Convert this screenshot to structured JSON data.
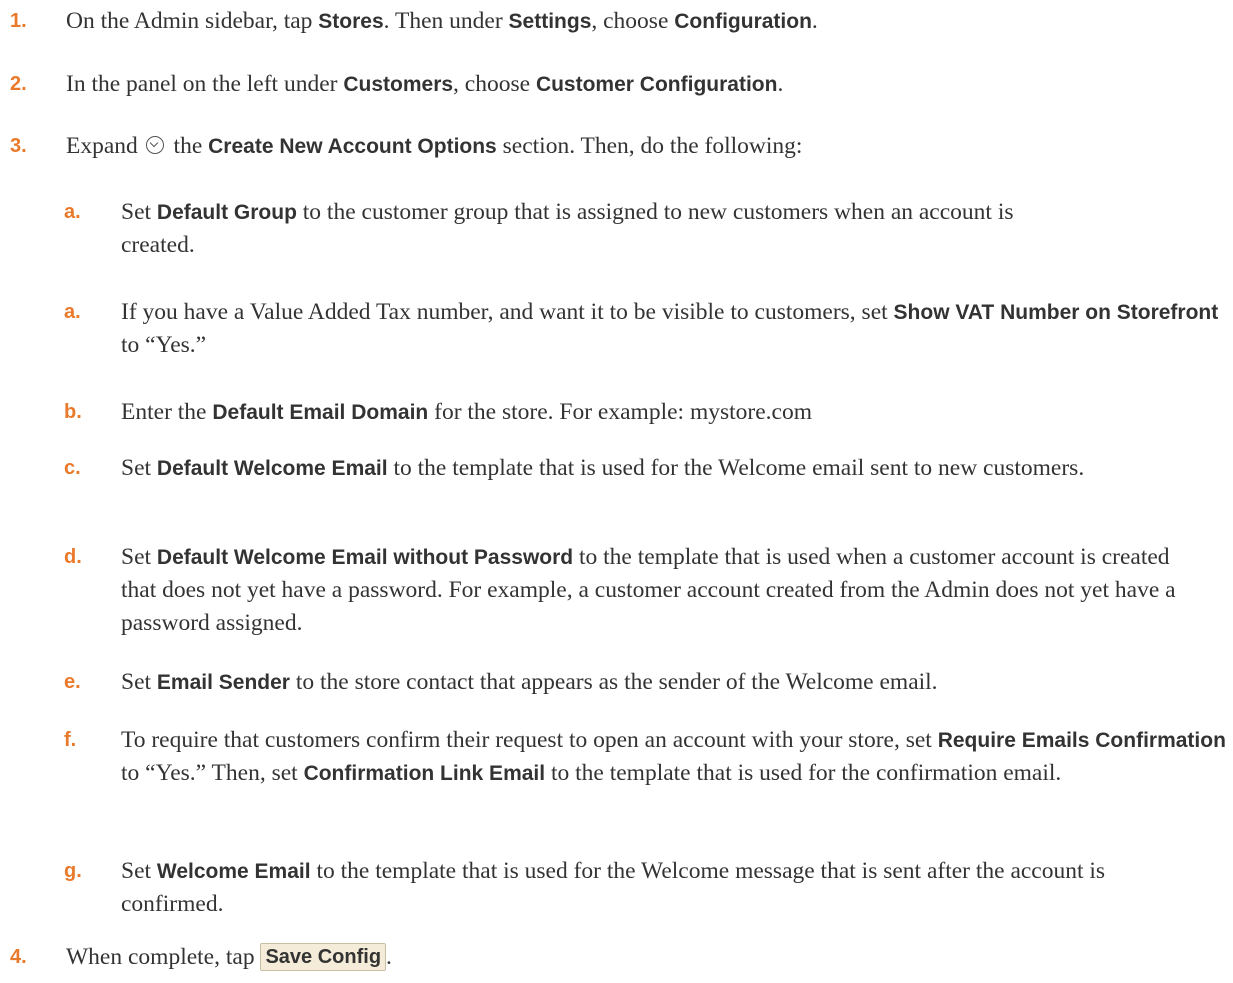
{
  "steps": {
    "s1": {
      "num": "1.",
      "t1": "On the Admin sidebar, tap ",
      "b1": "Stores",
      "t2": ". Then under ",
      "b2": "Settings",
      "t3": ", choose ",
      "b3": "Configuration",
      "t4": "."
    },
    "s2": {
      "num": "2.",
      "t1": "In the panel on the left under ",
      "b1": "Customers",
      "t2": ", choose ",
      "b2": "Customer Configuration",
      "t3": "."
    },
    "s3": {
      "num": "3.",
      "t1": "Expand ",
      "t2": " the ",
      "b1": "Create New Account Options",
      "t3": " section. Then, do the following:",
      "icon": "chevron-circle-down-icon"
    },
    "s4": {
      "num": "4.",
      "t1": "When complete, tap ",
      "button": "Save Config",
      "t2": "."
    }
  },
  "substeps": {
    "a1": {
      "num": "a.",
      "t1": "Set ",
      "b1": "Default Group",
      "t2": " to the customer group that is assigned to new customers when an account is created."
    },
    "a2": {
      "num": "a.",
      "t1": "If you have a Value Added Tax number, and want it to be visible to customers, set ",
      "b1": "Show VAT Number on Storefront",
      "t2": " to “Yes.”"
    },
    "b": {
      "num": "b.",
      "t1": "Enter the ",
      "b1": "Default Email Domain",
      "t2": " for the store. For example: mystore.com"
    },
    "c": {
      "num": "c.",
      "t1": "Set ",
      "b1": "Default Welcome Email",
      "t2": " to the template that is used for the Welcome email sent to new customers."
    },
    "d": {
      "num": "d.",
      "t1": "Set ",
      "b1": "Default Welcome Email without Password",
      "t2": " to the template that is used when a customer account is created that does not yet have a password. For example, a customer account created from the Admin does not yet have a password assigned."
    },
    "e": {
      "num": "e.",
      "t1": "Set ",
      "b1": "Email Sender",
      "t2": " to the store contact that appears as the sender of the Welcome email."
    },
    "f": {
      "num": "f.",
      "t1": "To require that customers confirm their request to open an account with your store, set ",
      "b1": "Require Emails Confirmation",
      "t2": " to “Yes.” Then, set ",
      "b2": "Confirmation Link Email",
      "t3": " to the template that is used for the confirmation email."
    },
    "g": {
      "num": "g.",
      "t1": "Set ",
      "b1": "Welcome Email",
      "t2": " to the template that is used for the Welcome message that is sent after the account is confirmed."
    }
  }
}
